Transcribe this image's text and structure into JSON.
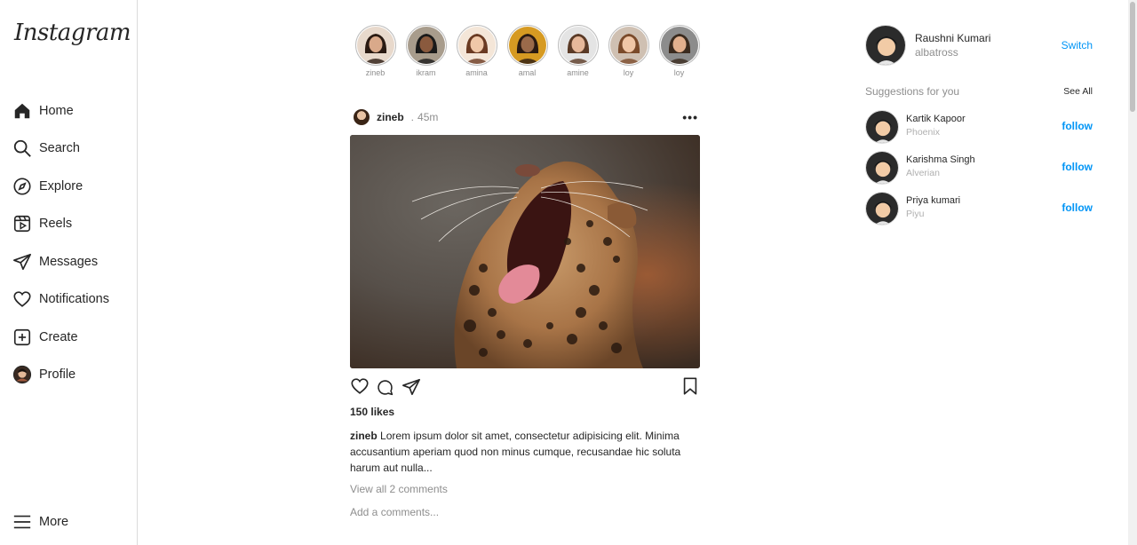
{
  "sidebar": {
    "logo": "Instagram",
    "items": [
      {
        "label": "Home",
        "icon": "home-icon"
      },
      {
        "label": "Search",
        "icon": "search-icon"
      },
      {
        "label": "Explore",
        "icon": "compass-icon"
      },
      {
        "label": "Reels",
        "icon": "reels-icon"
      },
      {
        "label": "Messages",
        "icon": "send-icon"
      },
      {
        "label": "Notifications",
        "icon": "heart-icon"
      },
      {
        "label": "Create",
        "icon": "plus-square-icon"
      },
      {
        "label": "Profile",
        "icon": "avatar-icon"
      }
    ],
    "more_label": "More"
  },
  "stories": [
    {
      "name": "zineb",
      "skin": "#d9a98a",
      "hair": "#2a1a12",
      "bg": "#e8d9cc"
    },
    {
      "name": "ikram",
      "skin": "#8a5a3e",
      "hair": "#1a1a1a",
      "bg": "#a89c8c"
    },
    {
      "name": "amina",
      "skin": "#f0c8a8",
      "hair": "#6a3a22",
      "bg": "#f4e6d8"
    },
    {
      "name": "amal",
      "skin": "#9a6a4a",
      "hair": "#2a1a12",
      "bg": "#d69a22"
    },
    {
      "name": "amine",
      "skin": "#e6b89a",
      "hair": "#5a3a26",
      "bg": "#e4e4e4"
    },
    {
      "name": "loy",
      "skin": "#f0c6a6",
      "hair": "#7a4a2a",
      "bg": "#cfc0b2"
    },
    {
      "name": "loy",
      "skin": "#e2b08e",
      "hair": "#3a2a1e",
      "bg": "#8c8c8c"
    }
  ],
  "post": {
    "user": "zineb",
    "dot": ".",
    "time": "45m",
    "more": "•••",
    "likes": "150 likes",
    "caption_user": "zineb",
    "caption_text": "Lorem ipsum dolor sit amet, consectetur adipisicing elit. Minima accusantium aperiam quod non minus cumque, recusandae hic soluta harum aut nulla...",
    "view_comments": "View all 2 comments",
    "comment_placeholder": "Add a comments..."
  },
  "right": {
    "name": "Raushni Kumari",
    "handle": "albatross",
    "switch": "Switch",
    "suggestions_title": "Suggestions for you",
    "see_all": "See All",
    "suggestions": [
      {
        "name": "Kartik Kapoor",
        "handle": "Phoenix",
        "action": "follow"
      },
      {
        "name": "Karishma Singh",
        "handle": "Alverian",
        "action": "follow"
      },
      {
        "name": "Priya kumari",
        "handle": "Piyu",
        "action": "follow"
      }
    ]
  },
  "colors": {
    "accent": "#0095f6",
    "text": "#262626",
    "muted": "#8e8e8e",
    "border": "#dbdbdb"
  }
}
